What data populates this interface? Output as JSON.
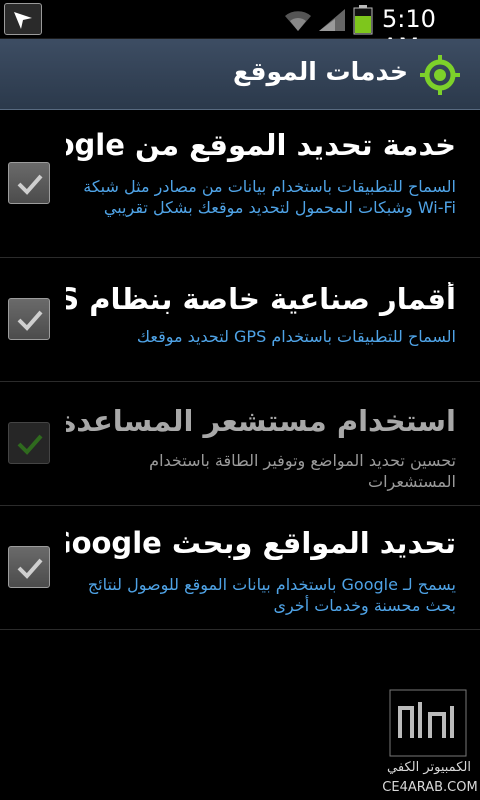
{
  "status_bar": {
    "time": "5:10 AM",
    "icons": [
      "notification-arrow-icon",
      "wifi-icon",
      "signal-icon",
      "battery-icon"
    ]
  },
  "title_bar": {
    "title": "خدمات الموقع",
    "icon": "location-target-icon"
  },
  "settings": [
    {
      "title": "خدمة تحديد الموقع من Google",
      "summary": "السماح للتطبيقات باستخدام بيانات من مصادر مثل شبكة Wi-Fi وشبكات المحمول لتحديد موقعك بشكل تقريبي",
      "checked": true,
      "enabled": true
    },
    {
      "title": "أقمار صناعية خاصة بنظام GPS",
      "summary": "السماح للتطبيقات باستخدام GPS لتحديد موقعك",
      "checked": true,
      "enabled": true
    },
    {
      "title": "استخدام مستشعر المساعدة",
      "summary": "تحسين تحديد المواضع وتوفير الطاقة باستخدام المستشعرات",
      "checked": true,
      "enabled": false
    },
    {
      "title": "تحديد المواقع وبحث Google",
      "summary": "يسمح لـ Google باستخدام بيانات الموقع للوصول لنتائج بحث محسنة وخدمات أخرى",
      "checked": true,
      "enabled": true
    }
  ],
  "colors": {
    "title_bar": "#33425a",
    "summary_text": "#4fa3e6",
    "location_icon": "#7dd12a"
  },
  "watermark": {
    "line1": "الكمبيوتر الكفي",
    "line2": "CE4ARAB.COM"
  }
}
